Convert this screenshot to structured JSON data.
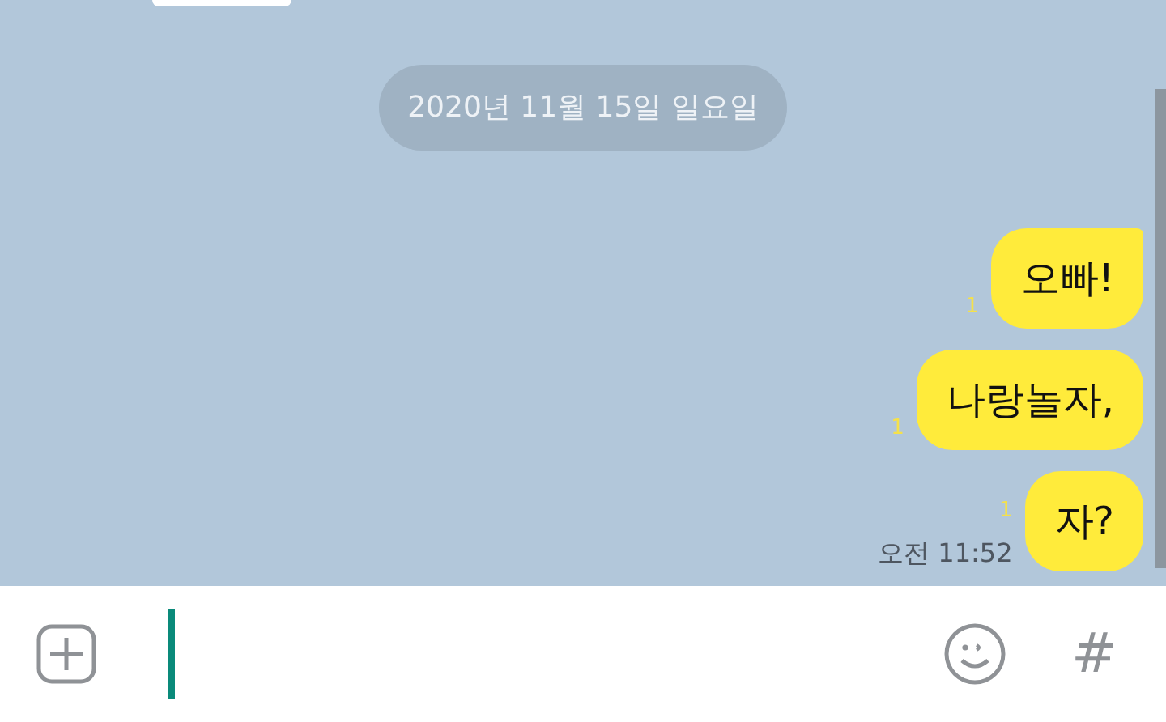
{
  "date_divider": "2020년 11월 15일 일요일",
  "messages": [
    {
      "text": "오빠!",
      "unread": "1",
      "tail": true
    },
    {
      "text": "나랑놀자,",
      "unread": "1",
      "tail": false
    },
    {
      "text": "자?",
      "unread": "1",
      "time": "오전 11:52",
      "tail": false
    }
  ],
  "composer": {
    "hashtag": "#"
  }
}
